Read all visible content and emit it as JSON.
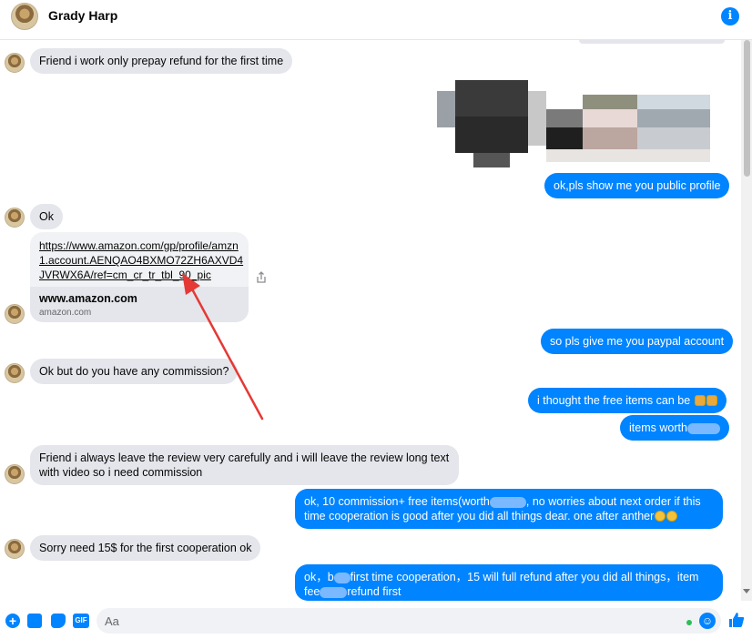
{
  "header": {
    "contact_name": "Grady Harp"
  },
  "messages": [
    {
      "from": "contact",
      "text": "Friend i work only prepay refund for the first time"
    },
    {
      "from": "me",
      "text": "ok,pls show me you public profile"
    },
    {
      "from": "contact",
      "text": "Ok"
    },
    {
      "from": "contact",
      "type": "link",
      "url": "https://www.amazon.com/gp/profile/amzn1.account.AENQAO4BXMO72ZH6AXVD4JVRWX6A/ref=cm_cr_tr_tbl_90_pic",
      "domain_title": "www.amazon.com",
      "domain_sub": "amazon.com"
    },
    {
      "from": "me",
      "text": "so pls give me you paypal account"
    },
    {
      "from": "contact",
      "text": "Ok but do you have any commission?"
    },
    {
      "from": "me",
      "text": "i thought the free items can be"
    },
    {
      "from": "me",
      "text": "items worth"
    },
    {
      "from": "contact",
      "text": "Friend i always leave the review very carefully and i will leave the review long text with video so i need commission"
    },
    {
      "from": "me",
      "text_a": "ok, 10 commission+ free items(worth",
      "text_b": ", no worries about next order if this time cooperation is good after you did all things dear.  one after anther"
    },
    {
      "from": "contact",
      "text": "Sorry need 15$ for the first cooperation ok"
    },
    {
      "from": "me",
      "text_a": "ok，b",
      "text_b": "first time cooperation，15 will full refund after you did all things，item fee",
      "text_c": "refund first"
    }
  ],
  "composer": {
    "placeholder": "Aa",
    "gif_label": "GIF",
    "plus_label": "+"
  },
  "colors": {
    "accent": "#0084ff",
    "incoming_bubble": "#e4e6eb",
    "annotation_arrow": "#e53935"
  }
}
